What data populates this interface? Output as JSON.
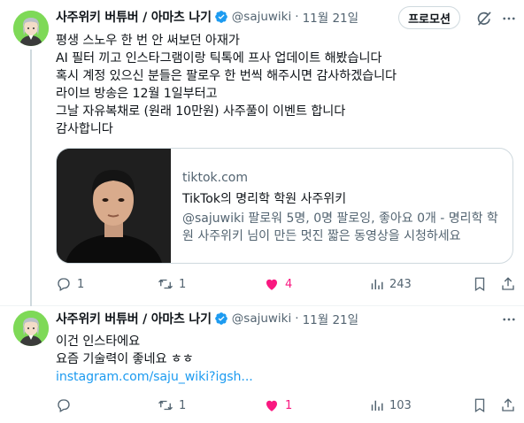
{
  "colors": {
    "accent": "#1d9bf0",
    "like": "#f91880",
    "muted": "#536471",
    "avatar_bg": "#7ed957"
  },
  "tweets": [
    {
      "author": "사주위키 버튜버 / 아마츠 나기",
      "handle": "@sajuwiki",
      "separator": "·",
      "time": "11월 21일",
      "promote_label": "프로모션",
      "lines": [
        "평생 스노우 한 번 안 써보던 아재가",
        "AI 필터 끼고 인스타그램이랑 틱톡에 프사 업데이트 해봤습니다",
        "혹시 계정 있으신 분들은 팔로우 한 번씩 해주시면 감사하겠습니다",
        "라이브 방송은 12월 1일부터고",
        "그날 자유복채로 (원래 10만원) 사주풀이 이벤트 합니다",
        "감사합니다"
      ],
      "card": {
        "domain": "tiktok.com",
        "title": "TikTok의 명리학 학원 사주위키",
        "description": "@sajuwiki 팔로워 5명, 0명 팔로잉, 좋아요 0개 - 명리학 학원 사주위키 님이 만든 멋진 짧은 동영상을 시청하세요"
      },
      "stats": {
        "replies": "1",
        "retweets": "1",
        "likes": "4",
        "views": "243"
      },
      "icons": [
        "verified-badge-icon",
        "grok-icon",
        "more-icon",
        "reply-icon",
        "retweet-icon",
        "heart-icon",
        "views-icon",
        "bookmark-icon",
        "share-icon"
      ]
    },
    {
      "author": "사주위키 버튜버 / 아마츠 나기",
      "handle": "@sajuwiki",
      "separator": "·",
      "time": "11월 21일",
      "lines": [
        "이건 인스타에요",
        "요즘 기술력이 좋네요 ㅎㅎ"
      ],
      "link": "instagram.com/saju_wiki?igsh...",
      "stats": {
        "replies": "",
        "retweets": "1",
        "likes": "1",
        "views": "103"
      }
    }
  ]
}
